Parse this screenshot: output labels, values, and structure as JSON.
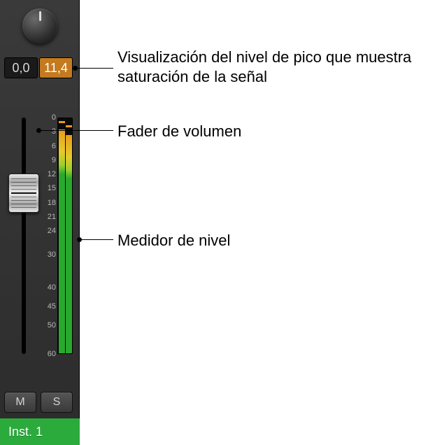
{
  "readouts": {
    "left": "0,0",
    "right": "11,4"
  },
  "meter_scale": [
    "0",
    "3",
    "6",
    "9",
    "12",
    "15",
    "18",
    "21",
    "24",
    "30",
    "40",
    "45",
    "50",
    "60"
  ],
  "buttons": {
    "mute": "M",
    "solo": "S"
  },
  "track_name": "Inst. 1",
  "annotations": {
    "peak": "Visualización del nivel de pico que muestra saturación de la señal",
    "fader": "Fader de volumen",
    "meter": "Medidor de nivel"
  },
  "colors": {
    "clip_bg": "#c47a1e",
    "track_bg": "#2bab3c"
  }
}
